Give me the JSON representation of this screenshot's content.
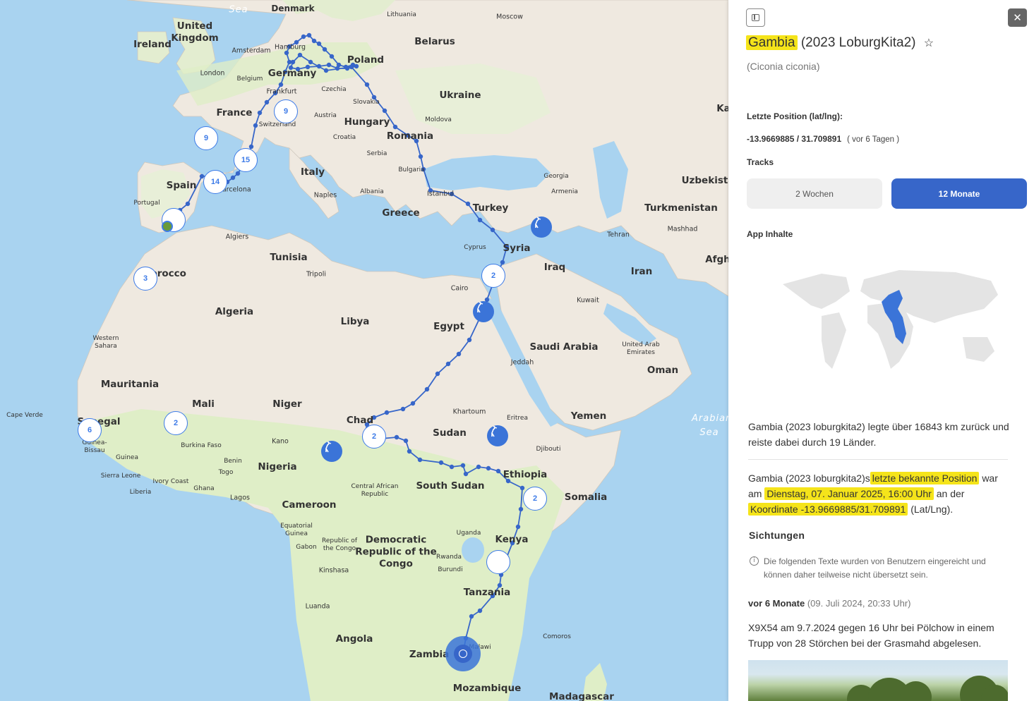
{
  "map": {
    "countries": [
      "Ireland",
      "United Kingdom",
      "France",
      "Spain",
      "Portugal",
      "Italy",
      "Germany",
      "Poland",
      "Belarus",
      "Ukraine",
      "Hungary",
      "Romania",
      "Greece",
      "Turkey",
      "Syria",
      "Iraq",
      "Iran",
      "Turkmenistan",
      "Uzbekista",
      "Afgh",
      "Ka",
      "Tunisia",
      "Algeria",
      "Libya",
      "Egypt",
      "Saudi Arabia",
      "Oman",
      "Yemen",
      "Western Sahara",
      "Mauritania",
      "Mali",
      "Niger",
      "Chad",
      "Sudan",
      "Nigeria",
      "Cameroon",
      "South Sudan",
      "Ethiopia",
      "Somalia",
      "Kenya",
      "Tanzania",
      "Angola",
      "Zambia",
      "Mozambique",
      "Madagascar",
      "Democratic Republic of the Congo",
      "Central African Republic",
      "Senegal",
      "Guinea-Bissau",
      "Guinea",
      "Sierra Leone",
      "Liberia",
      "Ivory Coast",
      "Ghana",
      "Burkina Faso",
      "Benin",
      "Togo",
      "Equatorial Guinea",
      "Gabon",
      "Republic of the Congo",
      "Uganda",
      "Rwanda",
      "Burundi",
      "Eritrea",
      "Djibouti",
      "Comoros",
      "Malawi",
      "Lithuania",
      "Denmark",
      "Czechia",
      "Slovakia",
      "Austria",
      "Switzerland",
      "Croatia",
      "Serbia",
      "Bulgaria",
      "Albania",
      "Moldova",
      "Georgia",
      "Armenia",
      "Cyprus",
      "Belgium",
      "Morocco",
      "Cape Verde",
      "United Arab Emirates"
    ],
    "cities": [
      "Amsterdam",
      "London",
      "Hamburg",
      "Frankfurt",
      "Barcelona",
      "Algiers",
      "Tripoli",
      "Cairo",
      "Istanbul",
      "Naples",
      "Tehran",
      "Mashhad",
      "Kuwait",
      "Jeddah",
      "Khartoum",
      "Kano",
      "Lagos",
      "Kinshasa",
      "Luanda",
      "Moscow"
    ],
    "seas": [
      "Sea",
      "Arabian Sea"
    ],
    "clusters": [
      "9",
      "9",
      "15",
      "14",
      "3",
      "2",
      "6",
      "2",
      "2",
      "2"
    ],
    "colors": {
      "water": "#a9d3f0",
      "land": "#efe9e0",
      "green": "#dfeec7",
      "track": "#3766c9",
      "accent": "#3766c9",
      "highlight": "#f5e41a"
    },
    "icons": [
      "stork-icon",
      "crosshair-icon"
    ]
  },
  "panel": {
    "name": "Gambia",
    "title_rest": "(2023 LoburgKita2)",
    "scientific": "(Ciconia ciconia)",
    "last_position_label": "Letzte Position (lat/lng):",
    "coords": "-13.9669885 / 31.709891",
    "coords_ago": "( vor 6 Tagen )",
    "tracks_label": "Tracks",
    "track_2w": "2 Wochen",
    "track_12m": "12 Monate",
    "app_content_label": "App Inhalte",
    "summary": "Gambia (2023 loburgkita2) legte über 16843 km zurück und reiste dabei durch 19 Länder.",
    "pos_pre": "Gambia (2023 loburgkita2)s",
    "pos_hl1": "letzte bekannte Position",
    "pos_mid1": "war am",
    "pos_hl2": "Dienstag, 07. Januar 2025, 16:00 Uhr",
    "pos_mid2": "an der",
    "pos_hl3": "Koordinate -13.9669885/31.709891",
    "pos_post": "(Lat/Lng).",
    "sightings_title": "Sichtungen",
    "sightings_note": "Die folgenden Texte wurden von Benutzern eingereicht und können daher teilweise nicht übersetzt sein.",
    "obs_time": "vor 6 Monate",
    "obs_date": "(09. Juli 2024, 20:33 Uhr)",
    "obs_text": "X9X54 am 9.7.2024 gegen 16 Uhr bei Pölchow in einem Trupp von 28 Störchen bei der Grasmahd abgelesen."
  }
}
